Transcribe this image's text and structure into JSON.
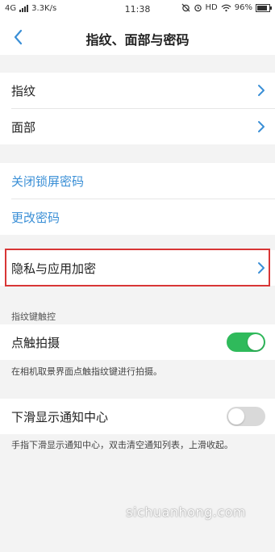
{
  "status_bar": {
    "network": "4G",
    "speed": "3.3K/s",
    "time": "11:38",
    "hd": "HD",
    "battery": "96%",
    "icons": [
      "signal-icon",
      "alarm-off-icon",
      "alarm-icon",
      "wifi-icon",
      "battery-icon"
    ]
  },
  "header": {
    "title": "指纹、面部与密码",
    "back_icon": "chevron-left-icon"
  },
  "biometrics": [
    {
      "label": "指纹"
    },
    {
      "label": "面部"
    }
  ],
  "password_links": [
    {
      "label": "关闭锁屏密码"
    },
    {
      "label": "更改密码"
    }
  ],
  "privacy": {
    "label": "隐私与应用加密"
  },
  "fingerprint_touch": {
    "section_title": "指纹键触控",
    "label": "点触拍摄",
    "enabled": true,
    "description": "在相机取景界面点触指纹键进行拍摄。"
  },
  "notification": {
    "label": "下滑显示通知中心",
    "enabled": false,
    "description": "手指下滑显示通知中心，双击清空通知列表，上滑收起。"
  },
  "watermark": "sichuanhong.com",
  "colors": {
    "accent_blue": "#3a8fd6",
    "toggle_on": "#2fba5b",
    "highlight_red": "#d83636"
  }
}
